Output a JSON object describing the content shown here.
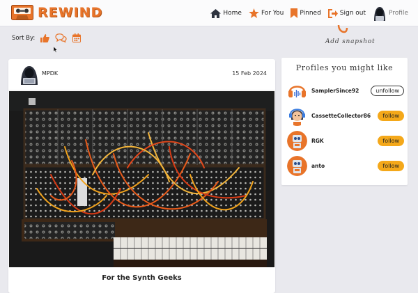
{
  "app": {
    "name": "REWIND"
  },
  "nav": {
    "home": "Home",
    "for_you": "For You",
    "pinned": "Pinned",
    "sign_out": "Sign out",
    "profile": "Profile"
  },
  "sort": {
    "label": "Sort By:"
  },
  "snapshot": {
    "add_label": "Add snapshot"
  },
  "post": {
    "author": "MPDK",
    "date": "15 Feb 2024",
    "title": "For the Synth Geeks"
  },
  "profiles": {
    "title": "Profiles you might like",
    "items": [
      {
        "name": "SamplerSince92",
        "action": "unfollow"
      },
      {
        "name": "CassetteCollector86",
        "action": "follow"
      },
      {
        "name": "RGK",
        "action": "follow"
      },
      {
        "name": "anto",
        "action": "follow"
      }
    ]
  },
  "colors": {
    "accent": "#e8742a",
    "follow": "#f4a81a"
  }
}
